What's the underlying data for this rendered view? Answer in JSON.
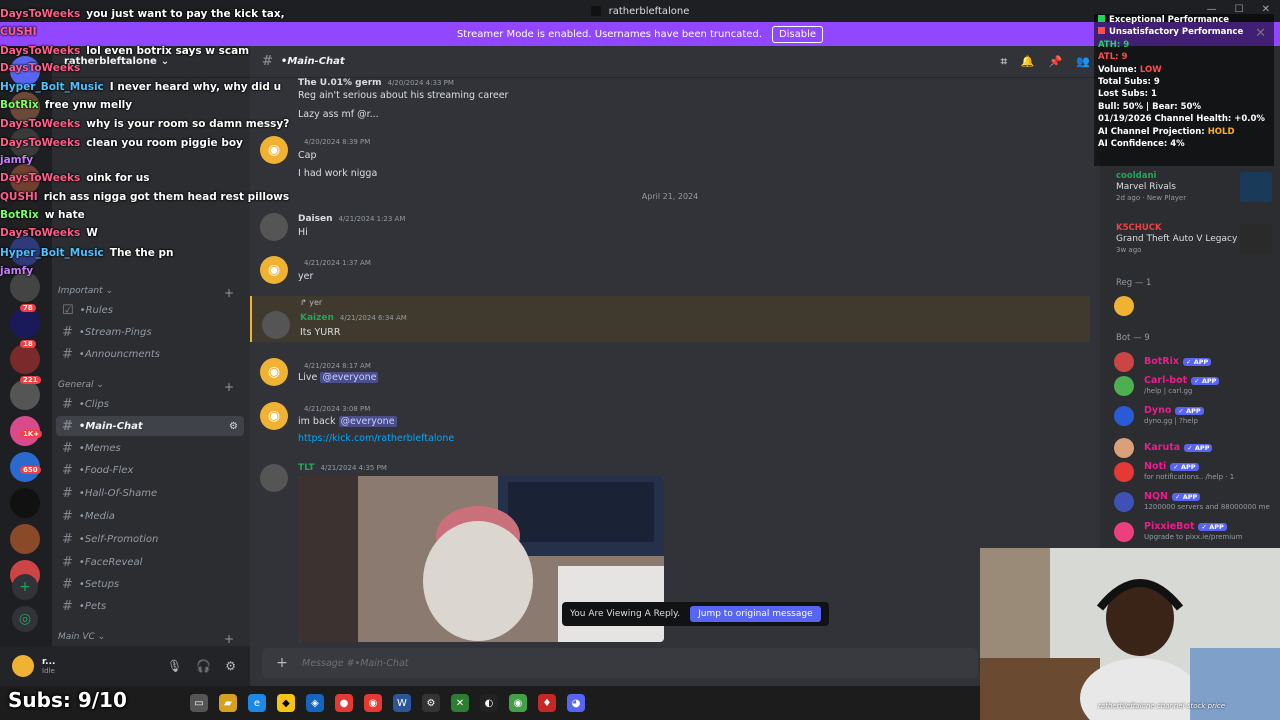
{
  "window": {
    "title": "ratherbleftalone"
  },
  "banner": {
    "text": "Streamer Mode is enabled. Usernames have been truncated.",
    "disable_label": "Disable"
  },
  "server": {
    "name": "ratherbleftalone"
  },
  "server_rail": {
    "badges": [
      "1",
      "78",
      "18",
      "221",
      "1K+",
      "650",
      "18",
      "1"
    ]
  },
  "channels": {
    "categories": [
      {
        "label": "Important"
      },
      {
        "label": "General"
      },
      {
        "label": "Main VC"
      }
    ],
    "important": [
      {
        "label": "Rules"
      },
      {
        "label": "Stream-Pings"
      },
      {
        "label": "Announcments"
      }
    ],
    "general": [
      {
        "label": "Clips"
      },
      {
        "label": "Main-Chat"
      },
      {
        "label": "Memes"
      },
      {
        "label": "Food-Flex"
      },
      {
        "label": "Hall-Of-Shame"
      },
      {
        "label": "Media"
      },
      {
        "label": "Self-Promotion"
      },
      {
        "label": "FaceReveal"
      },
      {
        "label": "Setups"
      },
      {
        "label": "Pets"
      }
    ]
  },
  "user_panel": {
    "name": "r...",
    "status": "Idle"
  },
  "chat": {
    "channel_name": "Main-Chat",
    "composer_placeholder": "Message #•Main-Chat",
    "date_divider": "April 21, 2024",
    "messages": [
      {
        "user": "The U.01% germ",
        "time": "4/20/2024 4:33 PM",
        "lines": [
          "Reg ain't serious about his streaming career",
          "Lazy ass mf @r..."
        ]
      },
      {
        "user": "",
        "time": "4/20/2024 8:39 PM",
        "lines": [
          "Cap",
          "I had work nigga"
        ]
      },
      {
        "user": "Daisen",
        "time": "4/21/2024 1:23 AM",
        "lines": [
          "Hi"
        ]
      },
      {
        "user": "",
        "time": "4/21/2024 1:37 AM",
        "lines": [
          "yer"
        ]
      },
      {
        "user": "Kaizen",
        "time": "4/21/2024 6:34 AM",
        "reply": "yer",
        "lines": [
          "Its YURR"
        ]
      },
      {
        "user": "",
        "time": "4/21/2024 8:17 AM",
        "lines": [
          "Live",
          "@everyone"
        ]
      },
      {
        "user": "",
        "time": "4/21/2024 3:08 PM",
        "lines": [
          "im back",
          "@everyone",
          "https://kick.com/ratherbleftalone"
        ]
      },
      {
        "user": "TLT",
        "time": "4/21/2024 4:35 PM",
        "lines": []
      }
    ],
    "reply_toast": {
      "text": "You Are Viewing A Reply.",
      "jump_label": "Jump to original message"
    }
  },
  "members": {
    "activity": [
      {
        "name": "cooldani",
        "status": "Marvel Rivals",
        "sub": "2d ago · New Player"
      },
      {
        "name": "K5CHUCK",
        "status": "Grand Theft Auto V Legacy",
        "sub": "3w ago"
      }
    ],
    "groups": [
      {
        "label": "Reg — 1"
      },
      {
        "label": "Bot — 9"
      }
    ],
    "bots": [
      {
        "name": "BotRix",
        "status": ""
      },
      {
        "name": "Carl-bot",
        "status": "/help | carl.gg"
      },
      {
        "name": "Dyno",
        "status": "dyno.gg | ?help"
      },
      {
        "name": "Karuta",
        "status": ""
      },
      {
        "name": "Noti",
        "status": "for notifications.. /help · 1"
      },
      {
        "name": "NQN",
        "status": "1200000 servers and 88000000 me"
      },
      {
        "name": "PixxieBot",
        "status": "Upgrade to pixx.ie/premium"
      }
    ],
    "app_tag": "✓ APP"
  },
  "stream_chat": [
    {
      "user": "DaysToWeeks",
      "color": "#ff5f8a",
      "text": "you just want to pay the kick tax,"
    },
    {
      "user": "CUSHI",
      "color": "#ff5f8a",
      "text": ""
    },
    {
      "user": "DaysToWeeks",
      "color": "#ff5f8a",
      "text": "lol even botrix says w scam"
    },
    {
      "user": "DaysToWeeks",
      "color": "#ff5f8a",
      "text": ""
    },
    {
      "user": "Hyper_Bolt_Music",
      "color": "#4fc3ff",
      "text": "I never heard why, why did u"
    },
    {
      "user": "BotRix",
      "color": "#7dff6b",
      "text": "free ynw melly"
    },
    {
      "user": "DaysToWeeks",
      "color": "#ff5f8a",
      "text": "why is your room so damn messy?"
    },
    {
      "user": "DaysToWeeks",
      "color": "#ff5f8a",
      "text": "clean you room piggie boy"
    },
    {
      "user": "jamfy",
      "color": "#c77dff",
      "text": ""
    },
    {
      "user": "DaysToWeeks",
      "color": "#ff5f8a",
      "text": "oink for us"
    },
    {
      "user": "QUSHI",
      "color": "#ff5f8a",
      "text": "rich ass nigga got them head rest pillows"
    },
    {
      "user": "BotRix",
      "color": "#7dff6b",
      "text": "w hate"
    },
    {
      "user": "DaysToWeeks",
      "color": "#ff5f8a",
      "text": "W"
    },
    {
      "user": "Hyper_Bolt_Music",
      "color": "#4fc3ff",
      "text": "The the pn"
    },
    {
      "user": "jamfy",
      "color": "#c77dff",
      "text": ""
    }
  ],
  "stats": {
    "legend_up": "Exceptional Performance",
    "legend_down": "Unsatisfactory Performance",
    "ath": "ATH: 9",
    "atl": "ATL: 9",
    "volume_label": "Volume:",
    "volume_value": "LOW",
    "total_subs": "Total Subs: 9",
    "lost_subs": "Lost Subs: 1",
    "bull_bear": "Bull: 50% | Bear: 50%",
    "channel_health": "01/19/2026 Channel Health: +0.0%",
    "projection_label": "AI Channel Projection:",
    "projection_value": "HOLD",
    "confidence": "AI Confidence: 4%",
    "colors": {
      "up": "#23d160",
      "down": "#ff4d4d",
      "hold": "#ffb020"
    }
  },
  "subs_counter": "Subs: 9/10",
  "webcam_caption": "ratherbleftalone channel stock price"
}
